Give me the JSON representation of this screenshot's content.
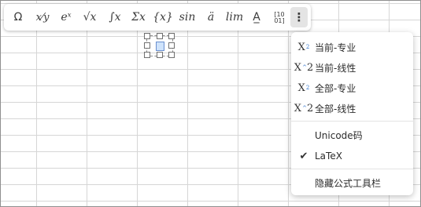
{
  "toolbar": {
    "buttons": [
      {
        "label": "Ω",
        "icon": "omega-symbol-icon"
      },
      {
        "label": "x⁄y",
        "icon": "fraction-icon"
      },
      {
        "label": "eˣ",
        "icon": "script-icon"
      },
      {
        "label": "√x",
        "icon": "radical-icon"
      },
      {
        "label": "∫x",
        "icon": "integral-icon"
      },
      {
        "label": "Σx",
        "icon": "large-operator-icon"
      },
      {
        "label": "{x}",
        "icon": "bracket-icon"
      },
      {
        "label": "sin",
        "icon": "function-icon"
      },
      {
        "label": "ä",
        "icon": "accent-icon"
      },
      {
        "label": "lim",
        "icon": "limit-icon"
      },
      {
        "label": "A̲",
        "icon": "operator-icon"
      },
      {
        "label": "[10 01]",
        "icon": "matrix-icon"
      },
      {
        "label": "⋮",
        "icon": "more-options-icon"
      }
    ]
  },
  "menu": {
    "items": [
      {
        "label": "当前-专业",
        "icon": "professional-format-icon"
      },
      {
        "label": "当前-线性",
        "icon": "linear-format-icon"
      },
      {
        "label": "全部-专业",
        "icon": "professional-format-icon"
      },
      {
        "label": "全部-线性",
        "icon": "linear-format-icon"
      },
      {
        "label": "Unicode码",
        "icon": ""
      },
      {
        "label": "LaTeX",
        "icon": "checkmark-icon",
        "checked": true
      },
      {
        "label": "隐藏公式工具栏",
        "icon": ""
      }
    ]
  }
}
